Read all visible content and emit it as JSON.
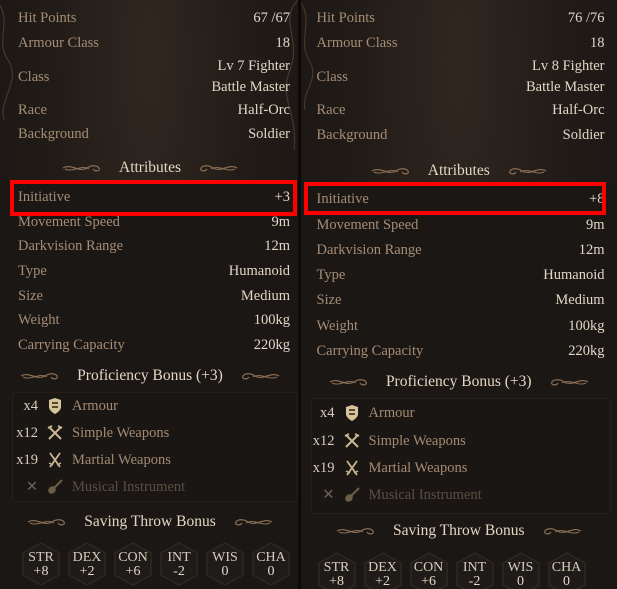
{
  "panels": [
    {
      "id": "left",
      "stats": [
        {
          "label": "Hit Points",
          "value": "67 /67"
        },
        {
          "label": "Armour Class",
          "value": "18"
        },
        {
          "label": "Class",
          "value": [
            "Lv 7 Fighter",
            "Battle Master"
          ]
        },
        {
          "label": "Race",
          "value": "Half-Orc"
        },
        {
          "label": "Background",
          "value": "Soldier"
        }
      ],
      "attributes_header": "Attributes",
      "attributes": [
        {
          "label": "Initiative",
          "value": "+3",
          "highlighted": true
        },
        {
          "label": "Movement Speed",
          "value": "9m"
        },
        {
          "label": "Darkvision Range",
          "value": "12m"
        },
        {
          "label": "Type",
          "value": "Humanoid"
        },
        {
          "label": "Size",
          "value": "Medium"
        },
        {
          "label": "Weight",
          "value": "100kg"
        },
        {
          "label": "Carrying Capacity",
          "value": "220kg"
        }
      ],
      "proficiency_header": "Proficiency Bonus (+3)",
      "proficiencies": [
        {
          "count": "x4",
          "icon": "armour-icon",
          "name": "Armour",
          "proficient": true
        },
        {
          "count": "x12",
          "icon": "simple-weapons-icon",
          "name": "Simple Weapons",
          "proficient": true
        },
        {
          "count": "x19",
          "icon": "martial-weapons-icon",
          "name": "Martial Weapons",
          "proficient": true
        },
        {
          "count": "✕",
          "icon": "musical-instrument-icon",
          "name": "Musical Instrument",
          "proficient": false
        }
      ],
      "saving_header": "Saving Throw Bonus",
      "saves": [
        {
          "ability": "STR",
          "bonus": "+8"
        },
        {
          "ability": "DEX",
          "bonus": "+2"
        },
        {
          "ability": "CON",
          "bonus": "+6"
        },
        {
          "ability": "INT",
          "bonus": "-2"
        },
        {
          "ability": "WIS",
          "bonus": "0"
        },
        {
          "ability": "CHA",
          "bonus": "0"
        }
      ]
    },
    {
      "id": "right",
      "stats": [
        {
          "label": "Hit Points",
          "value": "76 /76"
        },
        {
          "label": "Armour Class",
          "value": "18"
        },
        {
          "label": "Class",
          "value": [
            "Lv 8 Fighter",
            "Battle Master"
          ]
        },
        {
          "label": "Race",
          "value": "Half-Orc"
        },
        {
          "label": "Background",
          "value": "Soldier"
        }
      ],
      "attributes_header": "Attributes",
      "attributes": [
        {
          "label": "Initiative",
          "value": "+8",
          "highlighted": true
        },
        {
          "label": "Movement Speed",
          "value": "9m"
        },
        {
          "label": "Darkvision Range",
          "value": "12m"
        },
        {
          "label": "Type",
          "value": "Humanoid"
        },
        {
          "label": "Size",
          "value": "Medium"
        },
        {
          "label": "Weight",
          "value": "100kg"
        },
        {
          "label": "Carrying Capacity",
          "value": "220kg"
        }
      ],
      "proficiency_header": "Proficiency Bonus (+3)",
      "proficiencies": [
        {
          "count": "x4",
          "icon": "armour-icon",
          "name": "Armour",
          "proficient": true
        },
        {
          "count": "x12",
          "icon": "simple-weapons-icon",
          "name": "Simple Weapons",
          "proficient": true
        },
        {
          "count": "x19",
          "icon": "martial-weapons-icon",
          "name": "Martial Weapons",
          "proficient": true
        },
        {
          "count": "✕",
          "icon": "musical-instrument-icon",
          "name": "Musical Instrument",
          "proficient": false
        }
      ],
      "saving_header": "Saving Throw Bonus",
      "saves": [
        {
          "ability": "STR",
          "bonus": "+8"
        },
        {
          "ability": "DEX",
          "bonus": "+2"
        },
        {
          "ability": "CON",
          "bonus": "+6"
        },
        {
          "ability": "INT",
          "bonus": "-2"
        },
        {
          "ability": "WIS",
          "bonus": "0"
        },
        {
          "ability": "CHA",
          "bonus": "0"
        }
      ]
    }
  ],
  "colors": {
    "highlight": "#ff0000",
    "label": "#a68d75",
    "value": "#e2d6c6"
  }
}
